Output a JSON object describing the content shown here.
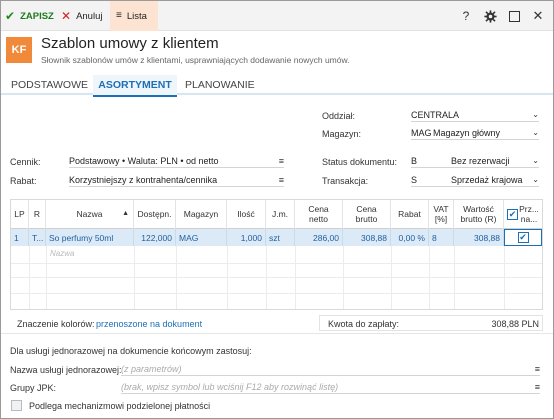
{
  "toolbar": {
    "save_label": "ZAPISZ",
    "cancel_label": "Anuluj",
    "list_label": "Lista",
    "save_icon": "check-icon",
    "cancel_icon": "x-icon",
    "list_icon": "menu-icon",
    "right_icons": [
      "help-icon",
      "gear-icon",
      "maximize-icon",
      "close-icon"
    ],
    "help_glyph": "?"
  },
  "header": {
    "badge": "KF",
    "title": "Szablon umowy z klientem",
    "subtitle": "Słownik szablonów umów z klientami, usprawniających dodawanie nowych umów."
  },
  "tabs": [
    "PODSTAWOWE",
    "ASORTYMENT",
    "PLANOWANIE"
  ],
  "active_tab": "ASORTYMENT",
  "form": {
    "oddzial": {
      "label": "Oddział:",
      "value": "CENTRALA"
    },
    "magazyn": {
      "label": "Magazyn:",
      "code": "MAG",
      "value": "Magazyn główny"
    },
    "cennik": {
      "label": "Cennik:",
      "value": "Podstawowy • Waluta: PLN • od netto"
    },
    "rabat": {
      "label": "Rabat:",
      "value": "Korzystniejszy z kontrahenta/cennika"
    },
    "status": {
      "label": "Status dokumentu:",
      "code": "B",
      "value": "Bez rezerwacji"
    },
    "transakcja": {
      "label": "Transakcja:",
      "code": "S",
      "value": "Sprzedaż krajowa"
    }
  },
  "grid": {
    "columns": [
      "LP",
      "R",
      "Nazwa",
      "Dostępn.",
      "Magazyn",
      "Ilość",
      "J.m.",
      "Cena netto",
      "Cena brutto",
      "Rabat",
      "VAT [%]",
      "Wartość brutto (R)",
      "Prz... na..."
    ],
    "sort_indicator": "▲",
    "rows": [
      {
        "lp": "1",
        "r": "T...",
        "nazwa": "So perfumy 50ml",
        "dostepn": "122,000",
        "magazyn": "MAG",
        "ilosc": "1,000",
        "jm": "szt",
        "cena_netto": "286,00",
        "cena_brutto": "308,88",
        "rabat": "0,00 %",
        "vat": "8",
        "wartosc": "308,88",
        "przeniesienie": true
      }
    ],
    "new_row_placeholder": "Nazwa"
  },
  "footer": {
    "colors_label": "Znaczenie kolorów:",
    "colors_link": "przenoszone na dokument",
    "amount_label": "Kwota do zapłaty:",
    "amount_value": "308,88 PLN",
    "service_heading": "Dla usługi jednorazowej na dokumencie końcowym zastosuj:",
    "service_name_label": "Nazwa usługi jednorazowej:",
    "service_name_placeholder": "(z parametrów)",
    "jpk_label": "Grupy JPK:",
    "jpk_placeholder": "(brak, wpisz symbol lub wciśnij F12 aby rozwinąć listę)",
    "split_payment_label": "Podlega mechanizmowi podzielonej płatności",
    "split_payment_checked": false
  }
}
